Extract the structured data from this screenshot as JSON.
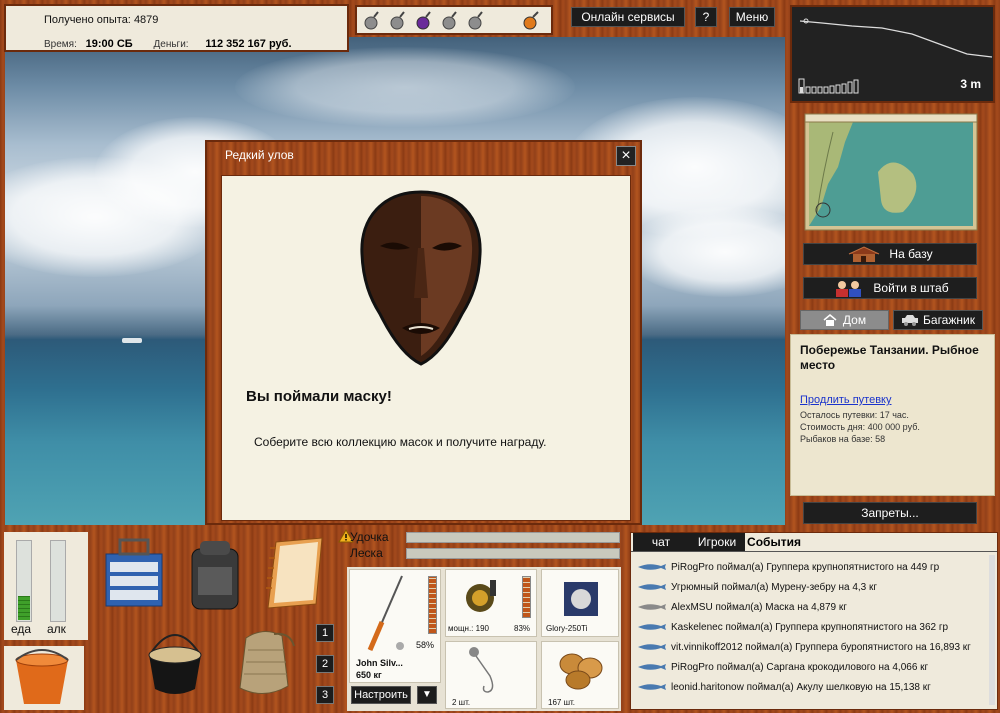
{
  "stats": {
    "exp_label": "Получено опыта:",
    "exp_value": "4879",
    "time_label": "Время:",
    "time_value": "19:00 СБ",
    "money_label": "Деньги:",
    "money_value": "112 352 167 руб."
  },
  "topbar": {
    "online_label": "Онлайн сервисы",
    "help_label": "?",
    "menu_label": "Меню"
  },
  "depth": {
    "value": "3 m"
  },
  "nav": {
    "base_label": "На базу",
    "hq_label": "Войти в штаб",
    "home_tab": "Дом",
    "trunk_tab": "Багажник",
    "bans_label": "Запреты..."
  },
  "location": {
    "title": "Побережье Танзании. Рыбное место",
    "extend_link": "Продлить путевку",
    "remaining": "Осталось путевки: 17 час.",
    "cost": "Стоимость дня: 400 000 руб.",
    "anglers": "Рыбаков на базе: 58"
  },
  "dialog": {
    "title": "Редкий улов",
    "heading": "Вы поймали маску!",
    "text": "Соберите всю коллекцию масок и получите награду."
  },
  "needs": {
    "food_label": "еда",
    "alc_label": "алк",
    "food_level": 0.3,
    "alc_level": 0
  },
  "slots": [
    "1",
    "2",
    "3"
  ],
  "tackle": {
    "rod_label": "Удочка",
    "line_label": "Леска",
    "rod_name": "John Silv...",
    "rod_weight": "650 кг",
    "rod_pct": "58%",
    "reel_power": "мощн.: 190",
    "reel_pct": "83%",
    "line_name": "Glory-250Ti",
    "hooks": "2 шт.",
    "bait": "167 шт.",
    "setup_label": "Настроить",
    "dropdown_icon": "▼"
  },
  "chat": {
    "tabs": [
      "чат",
      "Игроки",
      "События"
    ],
    "events": [
      "PiRogPro поймал(а) Группера крупнопятнистого на 449 гр",
      "Угрюмный поймал(а) Мурену-зебру на 4,3 кг",
      "AlexMSU поймал(а) Маска на 4,879 кг",
      "Kaskelenec поймал(а) Группера крупнопятнистого на 362 гр",
      "vit.vinnikoff2012 поймал(а) Группера буропятнистого на 16,893 кг",
      "PiRogPro поймал(а) Саргана крокодилового на 4,066 кг",
      "leonid.haritonow поймал(а) Акулу шелковую на 15,138 кг"
    ]
  },
  "colors": {
    "wood": "#a44a1c",
    "panel": "#efeadc",
    "dark_button": "#1c1c1c",
    "link": "#1a33cc"
  }
}
